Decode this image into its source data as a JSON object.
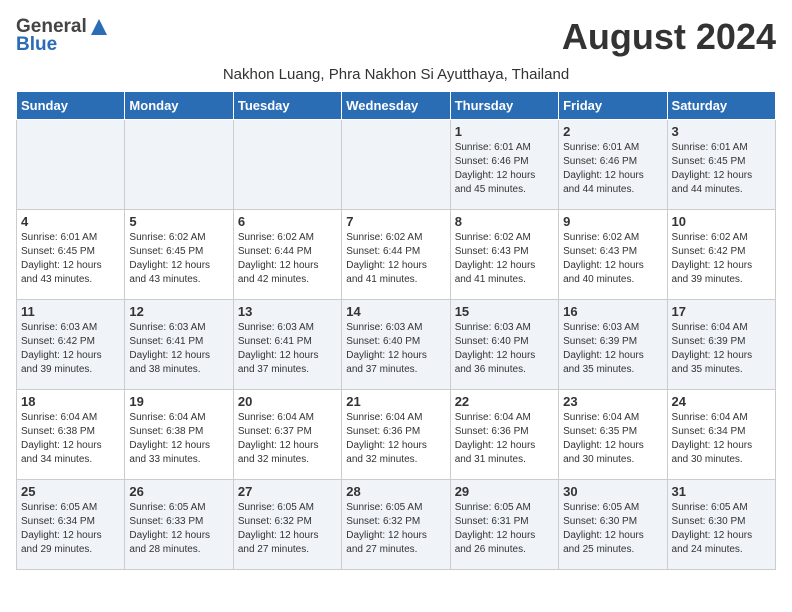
{
  "logo": {
    "general": "General",
    "blue": "Blue"
  },
  "title": "August 2024",
  "location": "Nakhon Luang, Phra Nakhon Si Ayutthaya, Thailand",
  "weekdays": [
    "Sunday",
    "Monday",
    "Tuesday",
    "Wednesday",
    "Thursday",
    "Friday",
    "Saturday"
  ],
  "weeks": [
    [
      {
        "day": "",
        "info": ""
      },
      {
        "day": "",
        "info": ""
      },
      {
        "day": "",
        "info": ""
      },
      {
        "day": "",
        "info": ""
      },
      {
        "day": "1",
        "info": "Sunrise: 6:01 AM\nSunset: 6:46 PM\nDaylight: 12 hours\nand 45 minutes."
      },
      {
        "day": "2",
        "info": "Sunrise: 6:01 AM\nSunset: 6:46 PM\nDaylight: 12 hours\nand 44 minutes."
      },
      {
        "day": "3",
        "info": "Sunrise: 6:01 AM\nSunset: 6:45 PM\nDaylight: 12 hours\nand 44 minutes."
      }
    ],
    [
      {
        "day": "4",
        "info": "Sunrise: 6:01 AM\nSunset: 6:45 PM\nDaylight: 12 hours\nand 43 minutes."
      },
      {
        "day": "5",
        "info": "Sunrise: 6:02 AM\nSunset: 6:45 PM\nDaylight: 12 hours\nand 43 minutes."
      },
      {
        "day": "6",
        "info": "Sunrise: 6:02 AM\nSunset: 6:44 PM\nDaylight: 12 hours\nand 42 minutes."
      },
      {
        "day": "7",
        "info": "Sunrise: 6:02 AM\nSunset: 6:44 PM\nDaylight: 12 hours\nand 41 minutes."
      },
      {
        "day": "8",
        "info": "Sunrise: 6:02 AM\nSunset: 6:43 PM\nDaylight: 12 hours\nand 41 minutes."
      },
      {
        "day": "9",
        "info": "Sunrise: 6:02 AM\nSunset: 6:43 PM\nDaylight: 12 hours\nand 40 minutes."
      },
      {
        "day": "10",
        "info": "Sunrise: 6:02 AM\nSunset: 6:42 PM\nDaylight: 12 hours\nand 39 minutes."
      }
    ],
    [
      {
        "day": "11",
        "info": "Sunrise: 6:03 AM\nSunset: 6:42 PM\nDaylight: 12 hours\nand 39 minutes."
      },
      {
        "day": "12",
        "info": "Sunrise: 6:03 AM\nSunset: 6:41 PM\nDaylight: 12 hours\nand 38 minutes."
      },
      {
        "day": "13",
        "info": "Sunrise: 6:03 AM\nSunset: 6:41 PM\nDaylight: 12 hours\nand 37 minutes."
      },
      {
        "day": "14",
        "info": "Sunrise: 6:03 AM\nSunset: 6:40 PM\nDaylight: 12 hours\nand 37 minutes."
      },
      {
        "day": "15",
        "info": "Sunrise: 6:03 AM\nSunset: 6:40 PM\nDaylight: 12 hours\nand 36 minutes."
      },
      {
        "day": "16",
        "info": "Sunrise: 6:03 AM\nSunset: 6:39 PM\nDaylight: 12 hours\nand 35 minutes."
      },
      {
        "day": "17",
        "info": "Sunrise: 6:04 AM\nSunset: 6:39 PM\nDaylight: 12 hours\nand 35 minutes."
      }
    ],
    [
      {
        "day": "18",
        "info": "Sunrise: 6:04 AM\nSunset: 6:38 PM\nDaylight: 12 hours\nand 34 minutes."
      },
      {
        "day": "19",
        "info": "Sunrise: 6:04 AM\nSunset: 6:38 PM\nDaylight: 12 hours\nand 33 minutes."
      },
      {
        "day": "20",
        "info": "Sunrise: 6:04 AM\nSunset: 6:37 PM\nDaylight: 12 hours\nand 32 minutes."
      },
      {
        "day": "21",
        "info": "Sunrise: 6:04 AM\nSunset: 6:36 PM\nDaylight: 12 hours\nand 32 minutes."
      },
      {
        "day": "22",
        "info": "Sunrise: 6:04 AM\nSunset: 6:36 PM\nDaylight: 12 hours\nand 31 minutes."
      },
      {
        "day": "23",
        "info": "Sunrise: 6:04 AM\nSunset: 6:35 PM\nDaylight: 12 hours\nand 30 minutes."
      },
      {
        "day": "24",
        "info": "Sunrise: 6:04 AM\nSunset: 6:34 PM\nDaylight: 12 hours\nand 30 minutes."
      }
    ],
    [
      {
        "day": "25",
        "info": "Sunrise: 6:05 AM\nSunset: 6:34 PM\nDaylight: 12 hours\nand 29 minutes."
      },
      {
        "day": "26",
        "info": "Sunrise: 6:05 AM\nSunset: 6:33 PM\nDaylight: 12 hours\nand 28 minutes."
      },
      {
        "day": "27",
        "info": "Sunrise: 6:05 AM\nSunset: 6:32 PM\nDaylight: 12 hours\nand 27 minutes."
      },
      {
        "day": "28",
        "info": "Sunrise: 6:05 AM\nSunset: 6:32 PM\nDaylight: 12 hours\nand 27 minutes."
      },
      {
        "day": "29",
        "info": "Sunrise: 6:05 AM\nSunset: 6:31 PM\nDaylight: 12 hours\nand 26 minutes."
      },
      {
        "day": "30",
        "info": "Sunrise: 6:05 AM\nSunset: 6:30 PM\nDaylight: 12 hours\nand 25 minutes."
      },
      {
        "day": "31",
        "info": "Sunrise: 6:05 AM\nSunset: 6:30 PM\nDaylight: 12 hours\nand 24 minutes."
      }
    ]
  ]
}
